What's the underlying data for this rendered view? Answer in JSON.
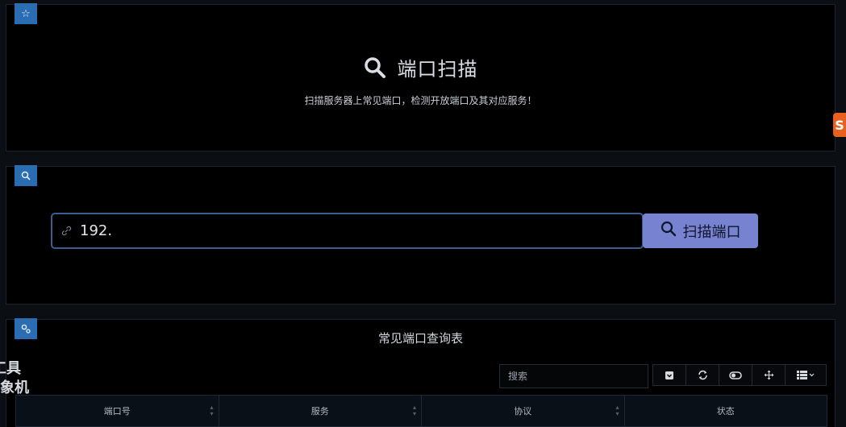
{
  "header": {
    "title": "端口扫描",
    "subtitle": "扫描服务器上常见端口，检测开放端口及其对应服务！"
  },
  "scan": {
    "input_value": "192.",
    "button_label": "扫描端口"
  },
  "table": {
    "title": "常见端口查询表",
    "search_placeholder": "搜索",
    "columns": [
      "端口号",
      "服务",
      "协议",
      "状态"
    ]
  },
  "side": {
    "line1": "工具",
    "line2": "象机"
  },
  "edge_badge": "S",
  "colors": {
    "accent_blue": "#2a6db3",
    "button_purple": "#7783d1",
    "badge_orange": "#e8611f"
  }
}
